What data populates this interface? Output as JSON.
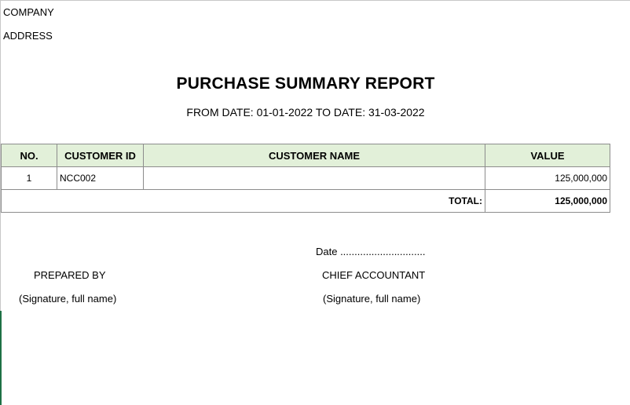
{
  "header": {
    "company": "COMPANY",
    "address": "ADDRESS",
    "title": "PURCHASE SUMMARY REPORT",
    "date_range": "FROM DATE: 01-01-2022 TO DATE: 31-03-2022"
  },
  "table": {
    "columns": [
      "NO.",
      "CUSTOMER ID",
      "CUSTOMER NAME",
      "VALUE"
    ],
    "rows": [
      {
        "no": "1",
        "customer_id": "NCC002",
        "customer_name": "",
        "value": "125,000,000"
      }
    ],
    "total_label": "TOTAL:",
    "total_value": "125,000,000"
  },
  "footer": {
    "date_line": "Date ..............................",
    "prepared_by": "PREPARED BY",
    "chief_accountant": "CHIEF ACCOUNTANT",
    "signature_left": "(Signature, full name)",
    "signature_right": "(Signature, full name)"
  },
  "colors": {
    "header_fill": "#e2f0d9",
    "grid_border": "#8c8c8c",
    "sheet_accent": "#1e7145"
  }
}
